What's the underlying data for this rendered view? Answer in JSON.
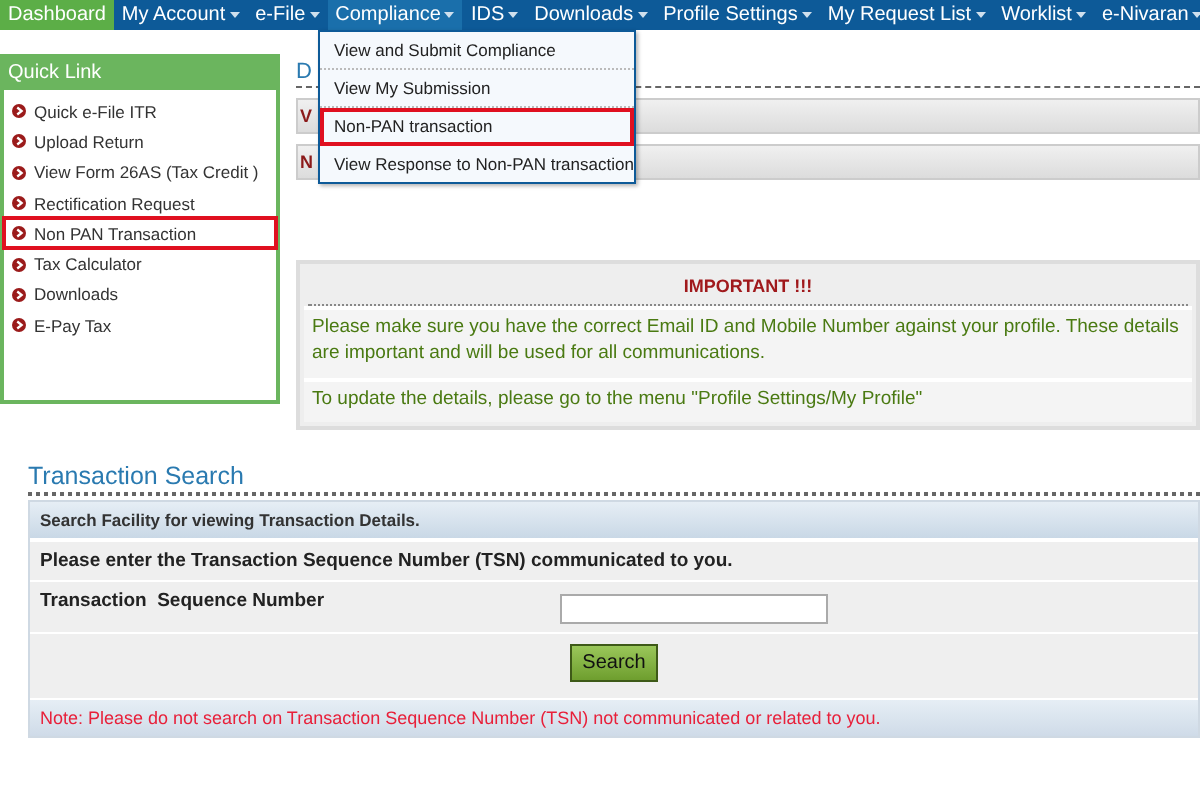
{
  "nav": {
    "items": [
      {
        "label": "Dashboard",
        "selected": true,
        "open": false,
        "has_menu": false
      },
      {
        "label": "My Account",
        "selected": false,
        "open": false,
        "has_menu": true
      },
      {
        "label": "e-File",
        "selected": false,
        "open": false,
        "has_menu": true
      },
      {
        "label": "Compliance",
        "selected": false,
        "open": true,
        "has_menu": true
      },
      {
        "label": "IDS",
        "selected": false,
        "open": false,
        "has_menu": true
      },
      {
        "label": "Downloads",
        "selected": false,
        "open": false,
        "has_menu": true
      },
      {
        "label": "Profile Settings",
        "selected": false,
        "open": false,
        "has_menu": true
      },
      {
        "label": "My Request List",
        "selected": false,
        "open": false,
        "has_menu": true
      },
      {
        "label": "Worklist",
        "selected": false,
        "open": false,
        "has_menu": true
      },
      {
        "label": "e-Nivaran",
        "selected": false,
        "open": false,
        "has_menu": true
      }
    ]
  },
  "dropdown": {
    "items": [
      {
        "label": "View and Submit Compliance",
        "highlighted": false
      },
      {
        "label": "View My Submission",
        "highlighted": false
      },
      {
        "label": "Non-PAN transaction",
        "highlighted": true
      },
      {
        "label": "View Response to Non-PAN transaction",
        "highlighted": false
      }
    ]
  },
  "quick_link": {
    "title": "Quick Link",
    "items": [
      {
        "label": "Quick e-File ITR",
        "highlighted": false
      },
      {
        "label": "Upload Return",
        "highlighted": false
      },
      {
        "label": "View Form 26AS (Tax Credit )",
        "highlighted": false
      },
      {
        "label": "Rectification Request",
        "highlighted": false
      },
      {
        "label": "Non PAN Transaction",
        "highlighted": true
      },
      {
        "label": "Tax Calculator",
        "highlighted": false
      },
      {
        "label": "Downloads",
        "highlighted": false
      },
      {
        "label": "E-Pay Tax",
        "highlighted": false
      }
    ]
  },
  "main": {
    "heading": "D",
    "rows": [
      "V",
      "N"
    ]
  },
  "important": {
    "title": "IMPORTANT !!!",
    "messages": [
      "Please make sure you have the correct Email ID and Mobile Number against your profile. These details are important and will be used for all communications.",
      "To update the details, please go to the menu \"Profile Settings/My Profile\""
    ]
  },
  "transaction_search": {
    "title": "Transaction Search",
    "panel_header": "Search Facility for viewing Transaction Details.",
    "instruction": "Please enter the Transaction Sequence Number (TSN) communicated to you.",
    "field_label": "Transaction  Sequence Number",
    "button": "Search",
    "note": "Note: Please do not search on Transaction Sequence Number (TSN) not communicated or related to you."
  }
}
